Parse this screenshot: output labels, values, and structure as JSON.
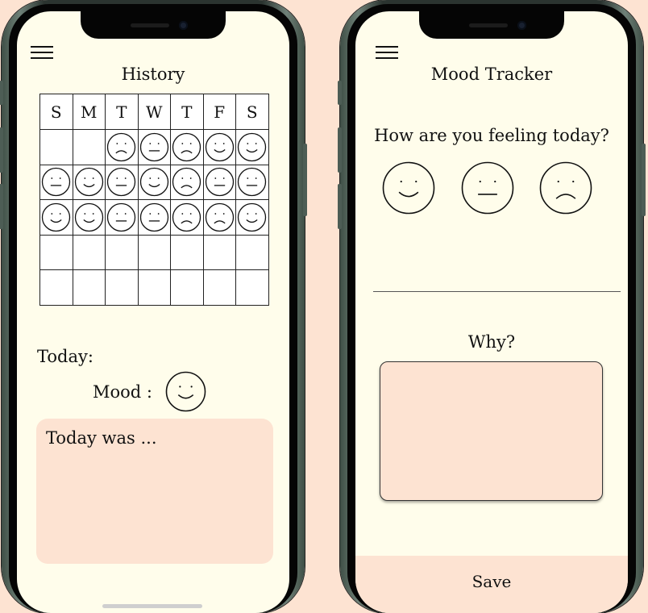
{
  "history_screen": {
    "title": "History",
    "weekdays": [
      "S",
      "M",
      "T",
      "W",
      "T",
      "F",
      "S"
    ],
    "calendar_rows": [
      [
        "",
        "",
        "sad",
        "neutral",
        "sad",
        "happy",
        "happy"
      ],
      [
        "neutral",
        "happy",
        "neutral",
        "happy",
        "sad",
        "neutral",
        "neutral"
      ],
      [
        "happy",
        "happy",
        "neutral",
        "neutral",
        "sad",
        "sad",
        "happy"
      ],
      [
        "",
        "",
        "",
        "",
        "",
        "",
        ""
      ],
      [
        "",
        "",
        "",
        "",
        "",
        "",
        ""
      ]
    ],
    "today_label": "Today:",
    "mood_label": "Mood :",
    "today_mood": "happy",
    "journal_text": "Today was ..."
  },
  "tracker_screen": {
    "title": "Mood Tracker",
    "question": "How are you feeling today?",
    "choices": [
      "happy",
      "neutral",
      "sad"
    ],
    "why_label": "Why?",
    "why_value": "",
    "save_label": "Save"
  },
  "colors": {
    "background": "#fde3d2",
    "screen": "#fffdeb",
    "accent_panel": "#fde3d2",
    "phone_frame": "#3f4f46"
  },
  "icons": {
    "menu": "hamburger-menu-icon",
    "happy": "happy-face-icon",
    "neutral": "neutral-face-icon",
    "sad": "sad-face-icon"
  }
}
